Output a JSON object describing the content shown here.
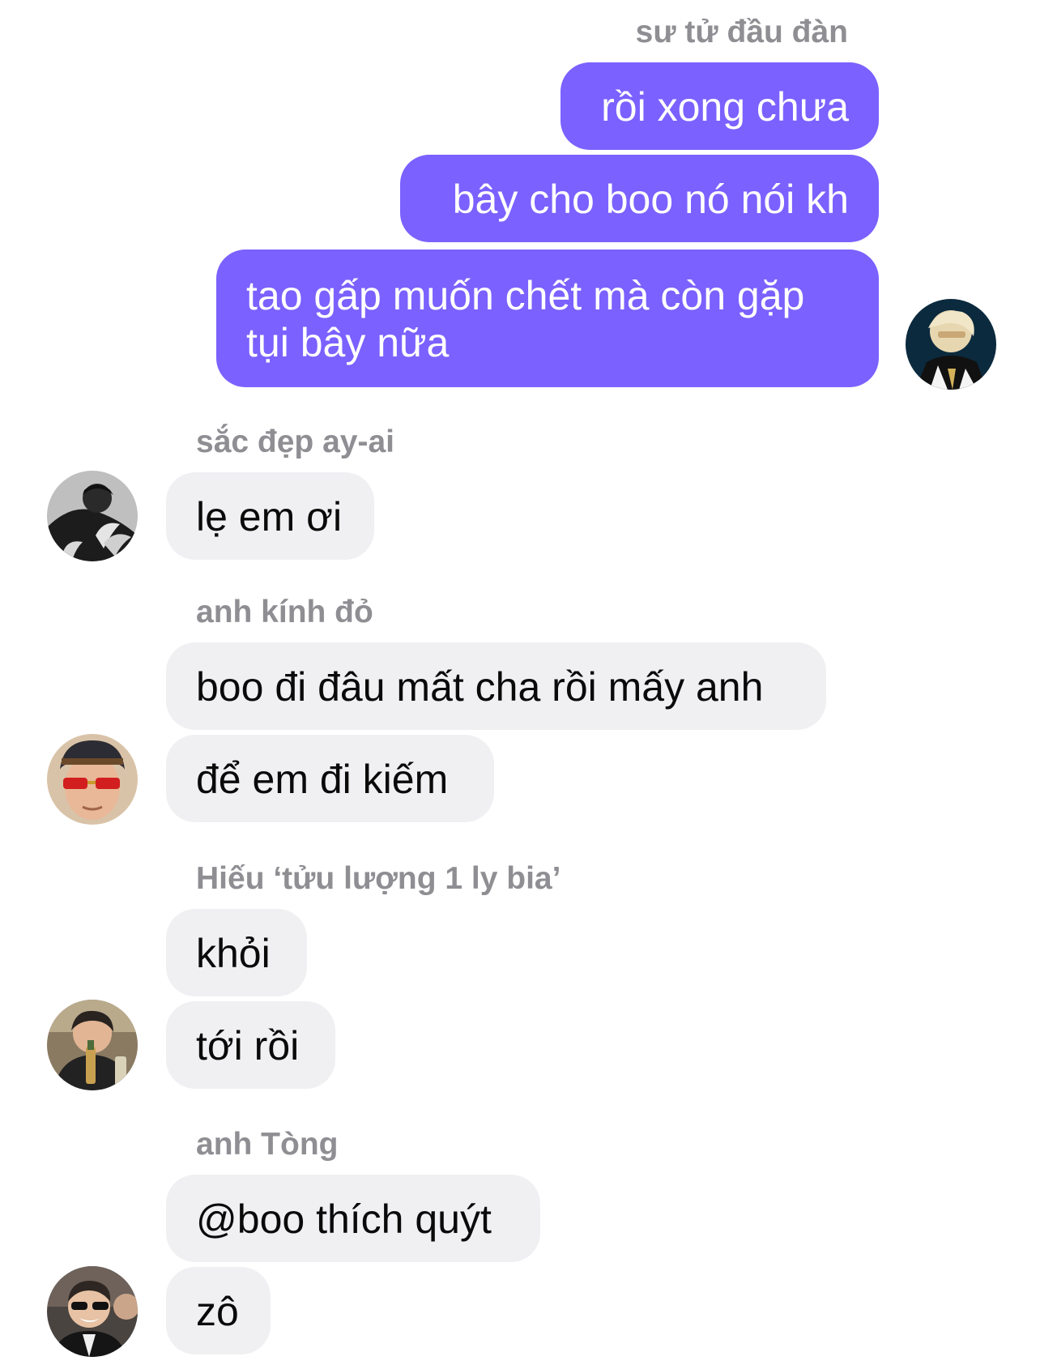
{
  "messages_outgoing": {
    "sender": "sư tử đầu đàn",
    "texts": [
      "rồi xong chưa",
      "bây cho boo nó nói kh",
      "tao gấp muốn chết mà còn gặp tụi bây nữa"
    ]
  },
  "groups": [
    {
      "sender": "sắc đẹp ay-ai",
      "texts": [
        "lẹ em ơi"
      ]
    },
    {
      "sender": "anh kính đỏ",
      "texts": [
        "boo đi đâu mất cha rồi mấy anh",
        "để em đi kiếm"
      ]
    },
    {
      "sender": "Hiếu ‘tửu lượng 1 ly bia’",
      "texts": [
        "khỏi",
        "tới rồi"
      ]
    },
    {
      "sender": "anh Tòng",
      "texts": [
        "@boo thích quýt",
        "zô"
      ]
    }
  ],
  "colors": {
    "outgoing_bubble": "#7b61ff",
    "incoming_bubble": "#f0f0f3",
    "sender_name": "#8e8e93"
  }
}
